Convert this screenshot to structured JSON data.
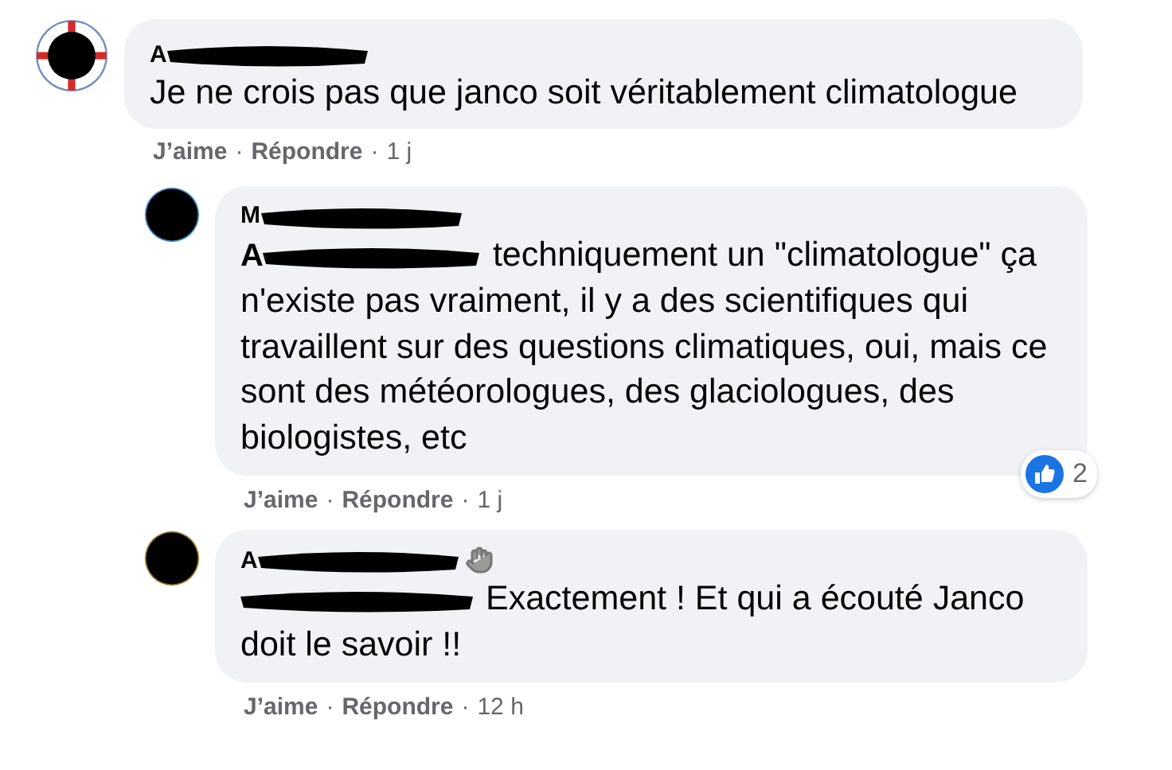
{
  "comments": [
    {
      "author": "A",
      "redacted_name": true,
      "author_badge": false,
      "redacted_mention": false,
      "text": "Je ne crois pas que janco soit véritablement climatologue",
      "like": "J’aime",
      "separator": "·",
      "reply": "Répondre",
      "separator_2": "·",
      "time": "1 j",
      "replies": [
        {
          "author": "M",
          "redacted_name": true,
          "author_badge": false,
          "redacted_mention": true,
          "mention_text": "A",
          "text": "techniquement un \"climatologue\" ça n'existe pas vraiment, il y a des scientifiques qui travaillent sur des questions climatiques, oui, mais ce sont des météorologues, des glaciologues, des biologistes, etc",
          "like": "J’aime",
          "separator": "·",
          "reply": "Répondre",
          "separator_2": "·",
          "time": "1 j",
          "reaction_count": "2"
        },
        {
          "author": "A",
          "redacted_name": true,
          "author_badge": true,
          "redacted_mention": true,
          "text": "Exactement ! Et qui a écouté Janco doit le savoir !!",
          "like": "J’aime",
          "separator": "·",
          "reply": "Répondre",
          "separator_2": "·",
          "time": "12 h"
        }
      ]
    }
  ]
}
